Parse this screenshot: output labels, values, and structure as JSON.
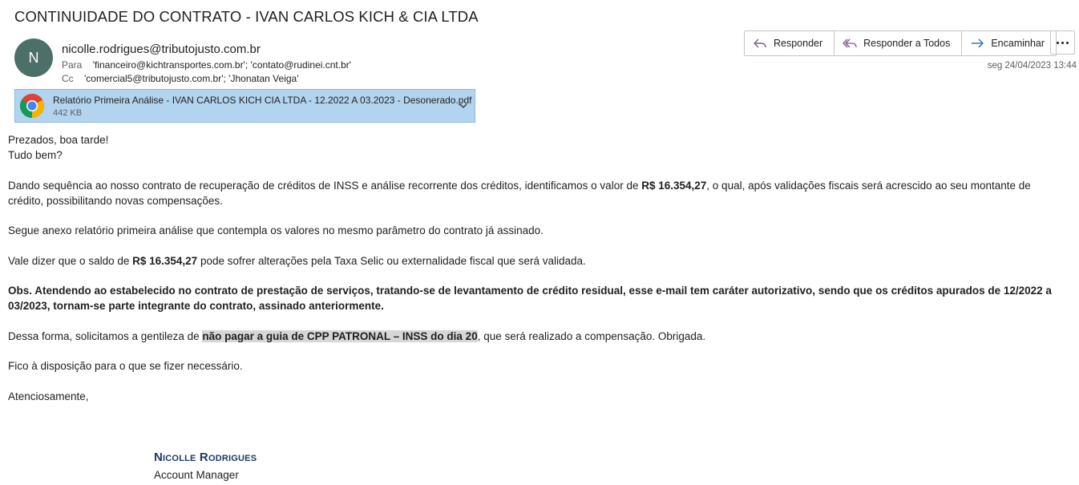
{
  "email": {
    "subject": "CONTINUIDADE DO CONTRATO - IVAN CARLOS KICH & CIA LTDA",
    "avatar_initial": "N",
    "avatar_color": "#4c6f68",
    "sender": "nicolle.rodrigues@tributojusto.com.br",
    "to_label": "Para",
    "to_value": "'financeiro@kichtransportes.com.br'; 'contato@rudinei.cnt.br'",
    "cc_label": "Cc",
    "cc_value": "'comercial5@tributojusto.com.br'; 'Jhonatan Veiga'",
    "date": "seg 24/04/2023 13:44"
  },
  "actions": {
    "reply": "Responder",
    "reply_all": "Responder a Todos",
    "forward": "Encaminhar",
    "reply_icon": "reply-icon",
    "reply_all_icon": "reply-all-icon",
    "forward_icon": "forward-icon",
    "more_icon": "more-icon",
    "accent_color": "#7a5a8c"
  },
  "attachment": {
    "name": "Relatório Primeira Análise - IVAN CARLOS KICH  CIA LTDA - 12.2022 A 03.2023 - Desonerado.pdf",
    "size": "442 KB",
    "icon": "chrome-icon",
    "bg_color": "#b3d4ef"
  },
  "body": {
    "greeting_1": "Prezados, boa tarde!",
    "greeting_2": "Tudo bem?",
    "p1_a": "Dando sequência ao nosso contrato de recuperação de créditos de INSS e análise recorrente dos créditos, identificamos o valor de ",
    "p1_amount": "R$ 16.354,27",
    "p1_b": ", o qual, após validações fiscais será acrescido ao seu montante de crédito, possibilitando novas compensações.",
    "p2": "Segue anexo relatório primeira análise que contempla os valores no mesmo parâmetro do contrato já assinado.",
    "p3_a": "Vale dizer que o saldo de ",
    "p3_amount": "R$ 16.354,27",
    "p3_b": " pode sofrer alterações pela Taxa Selic ou externalidade fiscal que será validada.",
    "p4": "Obs. Atendendo ao estabelecido no contrato de prestação de serviços, tratando-se de levantamento de crédito residual, esse e-mail tem caráter autorizativo, sendo que os créditos apurados de 12/2022 a 03/2023, tornam-se parte integrante do contrato, assinado anteriormente.",
    "p5_a": "Dessa forma, solicitamos a gentileza de ",
    "p5_highlight": "não pagar a guia de CPP PATRONAL – INSS do dia 20",
    "p5_b": ", que será realizado a compensação. Obrigada.",
    "p6": "Fico à disposição para o que se fizer necessário.",
    "closing": "Atenciosamente,"
  },
  "signature": {
    "name": "Nicolle Rodrigues",
    "role": "Account Manager",
    "name_color": "#1f3864"
  }
}
